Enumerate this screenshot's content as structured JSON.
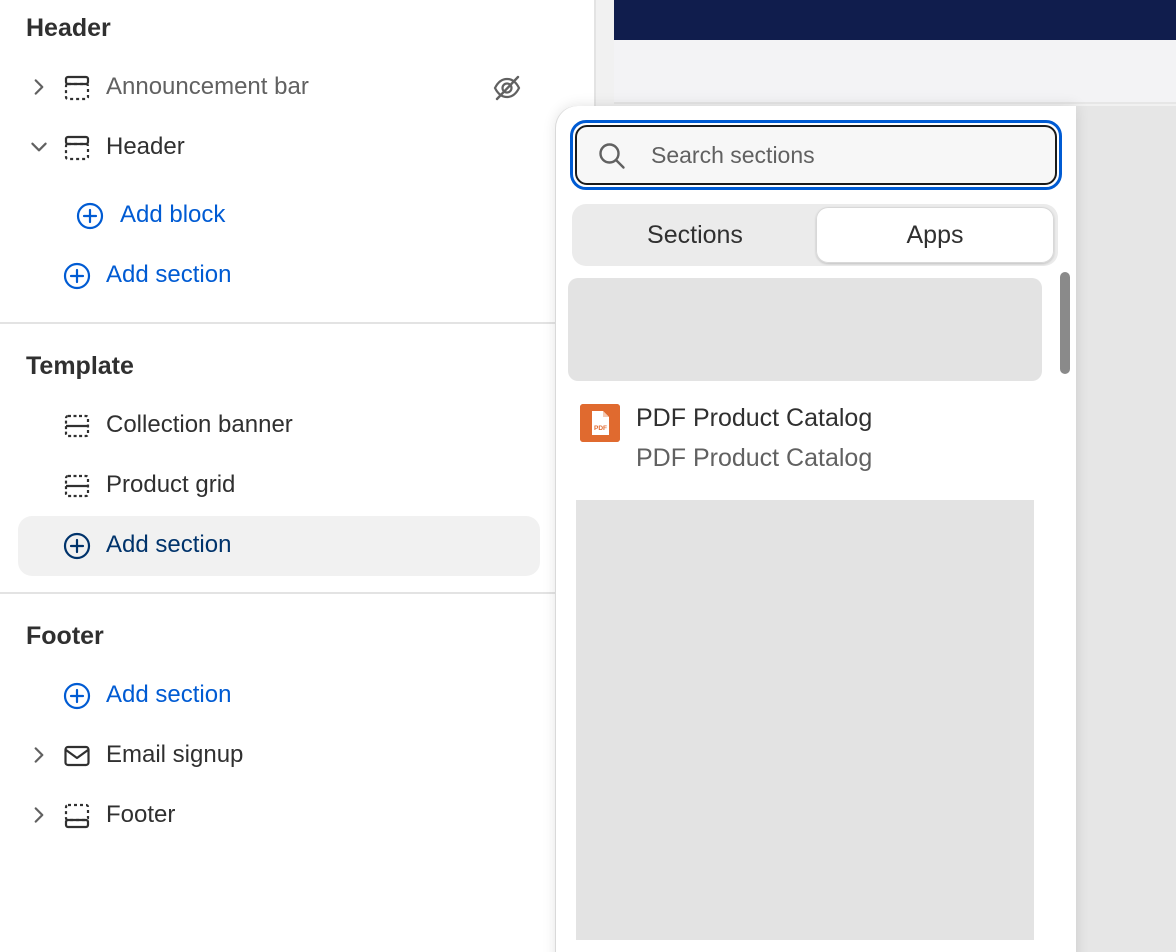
{
  "sidebar": {
    "header_group": {
      "title": "Header",
      "items": [
        {
          "label": "Announcement bar",
          "hidden": true
        },
        {
          "label": "Header",
          "expanded": true
        }
      ],
      "add_block": "Add block",
      "add_section": "Add section"
    },
    "template_group": {
      "title": "Template",
      "items": [
        {
          "label": "Collection banner"
        },
        {
          "label": "Product grid"
        }
      ],
      "add_section": "Add section"
    },
    "footer_group": {
      "title": "Footer",
      "add_section": "Add section",
      "items": [
        {
          "label": "Email signup"
        },
        {
          "label": "Footer"
        }
      ]
    }
  },
  "picker": {
    "search_placeholder": "Search sections",
    "tabs": [
      {
        "label": "Sections",
        "selected": false
      },
      {
        "label": "Apps",
        "selected": true
      }
    ],
    "apps": [
      {
        "name": "PDF Product Catalog",
        "subtitle": "PDF Product Catalog",
        "icon": "pdf-file-icon",
        "icon_badge": "PDF"
      }
    ]
  },
  "colors": {
    "link": "#005bd3",
    "focus_ring": "#005bd3",
    "preview_bar": "#101d4d",
    "app_icon": "#e06a2f"
  }
}
